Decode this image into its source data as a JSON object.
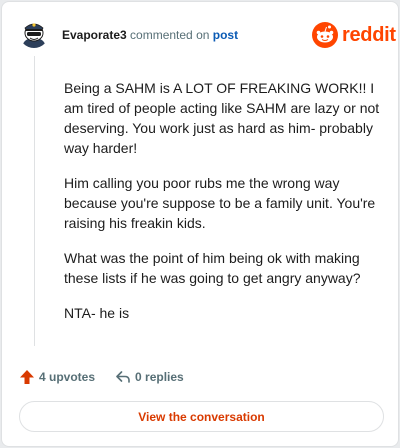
{
  "header": {
    "username": "Evaporate3",
    "action_text": " commented on ",
    "target_link": "post",
    "brand": "reddit"
  },
  "comment": {
    "paragraphs": [
      "Being a SAHM is A LOT OF FREAKING WORK!! I am tired of people acting like SAHM are lazy or not deserving. You work just as hard as him- probably way harder!",
      "Him calling you poor rubs me the wrong way because you're suppose to be a family unit. You're raising his freakin kids.",
      "What was the point of him being ok with making these lists if he was going to get angry anyway?",
      "NTA- he is"
    ]
  },
  "actions": {
    "upvotes": "4 upvotes",
    "replies": "0 replies"
  },
  "cta": {
    "label": "View the conversation"
  },
  "colors": {
    "brand": "#ff4500",
    "link": "#0a5ab4",
    "upvote": "#d93a00",
    "muted": "#576f76"
  }
}
